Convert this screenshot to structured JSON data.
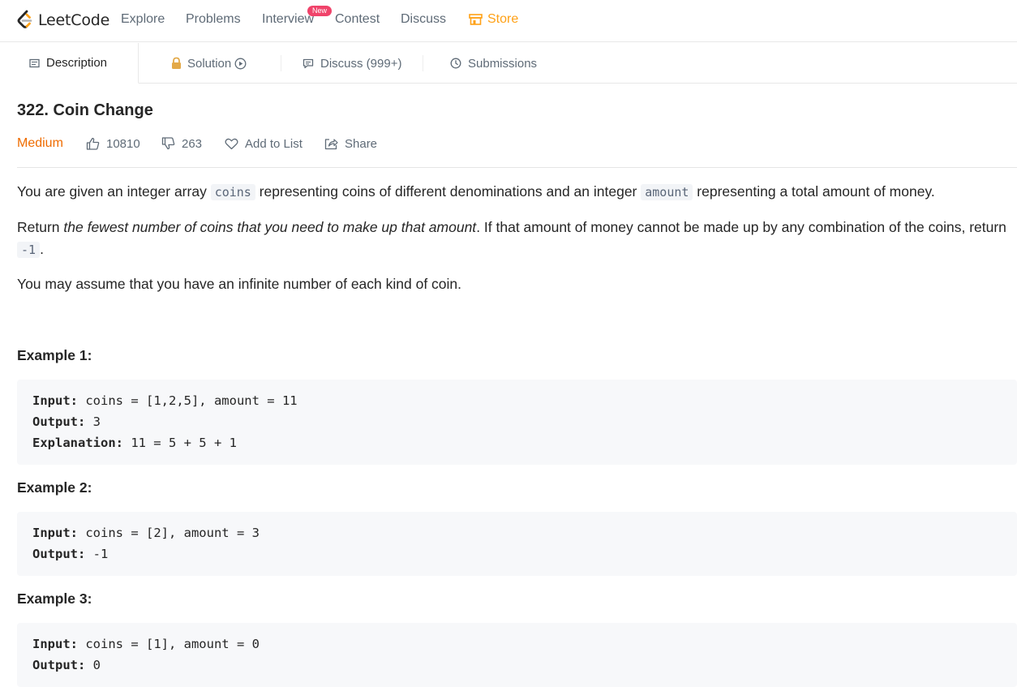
{
  "brand": {
    "logo_text": "LeetCode",
    "accent": "#ffa116"
  },
  "nav": {
    "items": [
      "Explore",
      "Problems",
      "Interview",
      "Contest",
      "Discuss",
      "Store"
    ],
    "new_badge": "New"
  },
  "tabs": {
    "description": "Description",
    "solution": "Solution",
    "discuss": "Discuss (999+)",
    "submissions": "Submissions"
  },
  "problem": {
    "title": "322. Coin Change",
    "difficulty": "Medium",
    "likes": "10810",
    "dislikes": "263",
    "add_to_list": "Add to List",
    "share": "Share"
  },
  "description": {
    "p1_a": "You are given an integer array ",
    "p1_code1": "coins",
    "p1_b": " representing coins of different denominations and an integer ",
    "p1_code2": "amount",
    "p1_c": " representing a total amount of money.",
    "p2_a": "Return ",
    "p2_em": "the fewest number of coins that you need to make up that amount",
    "p2_b": ". If that amount of money cannot be made up by any combination of the coins, return",
    "p2_code": "-1",
    "p2_c": ".",
    "p3": "You may assume that you have an infinite number of each kind of coin."
  },
  "examples": [
    {
      "title": "Example 1:",
      "input_label": "Input:",
      "input": " coins = [1,2,5], amount = 11",
      "output_label": "Output:",
      "output": " 3",
      "explanation_label": "Explanation:",
      "explanation": " 11 = 5 + 5 + 1"
    },
    {
      "title": "Example 2:",
      "input_label": "Input:",
      "input": " coins = [2], amount = 3",
      "output_label": "Output:",
      "output": " -1"
    },
    {
      "title": "Example 3:",
      "input_label": "Input:",
      "input": " coins = [1], amount = 0",
      "output_label": "Output:",
      "output": " 0"
    }
  ],
  "icons": {
    "logo": "leetcode-logo-icon",
    "store": "store-icon",
    "description": "description-icon",
    "lock": "lock-icon",
    "play": "play-circle-icon",
    "discuss": "chat-icon",
    "submissions": "clock-icon",
    "like": "thumbs-up-icon",
    "dislike": "thumbs-down-icon",
    "heart": "heart-icon",
    "share": "share-icon"
  }
}
